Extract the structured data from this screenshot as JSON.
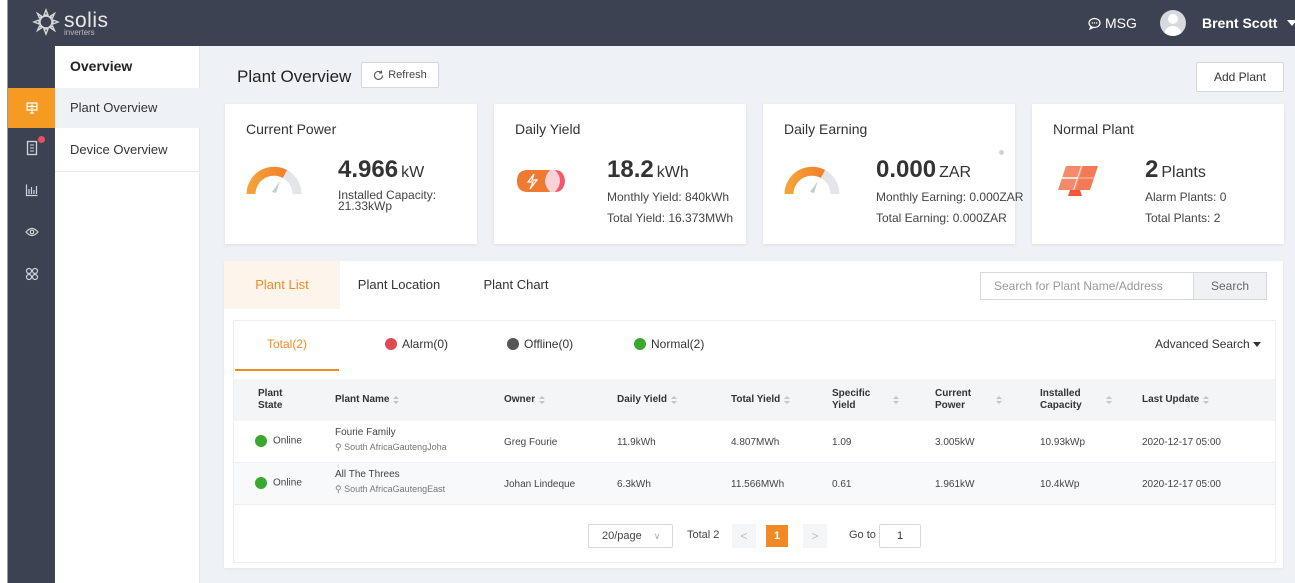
{
  "topbar": {
    "logo_text": "solis",
    "logo_sub": "inverters",
    "msg_label": "MSG",
    "user_name": "Brent Scott"
  },
  "sidebar": {
    "title": "Overview",
    "items": [
      {
        "label": "Plant Overview",
        "active": true
      },
      {
        "label": "Device Overview",
        "active": false
      }
    ]
  },
  "header": {
    "title": "Plant Overview",
    "refresh_label": "Refresh",
    "add_plant_label": "Add Plant"
  },
  "cards": {
    "current_power": {
      "title": "Current Power",
      "value": "4.966",
      "unit": "kW",
      "installed_label": "Installed Capacity:",
      "installed_value": "21.33kWp"
    },
    "daily_yield": {
      "title": "Daily Yield",
      "value": "18.2",
      "unit": "kWh",
      "monthly": "Monthly Yield: 840kWh",
      "total": "Total Yield: 16.373MWh"
    },
    "daily_earning": {
      "title": "Daily Earning",
      "value": "0.000",
      "unit": "ZAR",
      "monthly": "Monthly Earning: 0.000ZAR",
      "total": "Total Earning: 0.000ZAR"
    },
    "normal_plant": {
      "title": "Normal Plant",
      "value": "2",
      "unit": "Plants",
      "alarm": "Alarm Plants: 0",
      "total": "Total Plants: 2"
    }
  },
  "tabs": [
    {
      "label": "Plant List",
      "active": true
    },
    {
      "label": "Plant Location",
      "active": false
    },
    {
      "label": "Plant Chart",
      "active": false
    }
  ],
  "search": {
    "placeholder": "Search for Plant Name/Address",
    "button_label": "Search"
  },
  "filters": {
    "total": "Total(2)",
    "alarm": "Alarm(0)",
    "offline": "Offline(0)",
    "normal": "Normal(2)",
    "advanced": "Advanced Search"
  },
  "table": {
    "columns": [
      "Plant State",
      "Plant Name",
      "Owner",
      "Daily Yield",
      "Total Yield",
      "Specific Yield",
      "Current Power",
      "Installed Capacity",
      "Last Update"
    ],
    "rows": [
      {
        "state": "Online",
        "name": "Fourie Family",
        "address": "South AfricaGautengJoha...",
        "owner": "Greg Fourie",
        "daily_yield": "11.9kWh",
        "total_yield": "4.807MWh",
        "specific_yield": "1.09",
        "current_power": "3.005kW",
        "installed_capacity": "10.93kWp",
        "last_update": "2020-12-17 05:00"
      },
      {
        "state": "Online",
        "name": "All The Threes",
        "address": "South AfricaGautengEast ...",
        "owner": "Johan Lindeque",
        "daily_yield": "6.3kWh",
        "total_yield": "11.566MWh",
        "specific_yield": "0.61",
        "current_power": "1.961kW",
        "installed_capacity": "10.4kWp",
        "last_update": "2020-12-17 05:00"
      }
    ]
  },
  "pager": {
    "page_size": "20/page",
    "total": "Total 2",
    "current_page": "1",
    "goto_label": "Go to",
    "goto_value": "1"
  },
  "colors": {
    "accent": "#f08a24",
    "topbar": "#3c4251",
    "online": "#3aa82e",
    "alarm": "#e04a53",
    "offline": "#555555",
    "normal": "#3aa82e"
  }
}
